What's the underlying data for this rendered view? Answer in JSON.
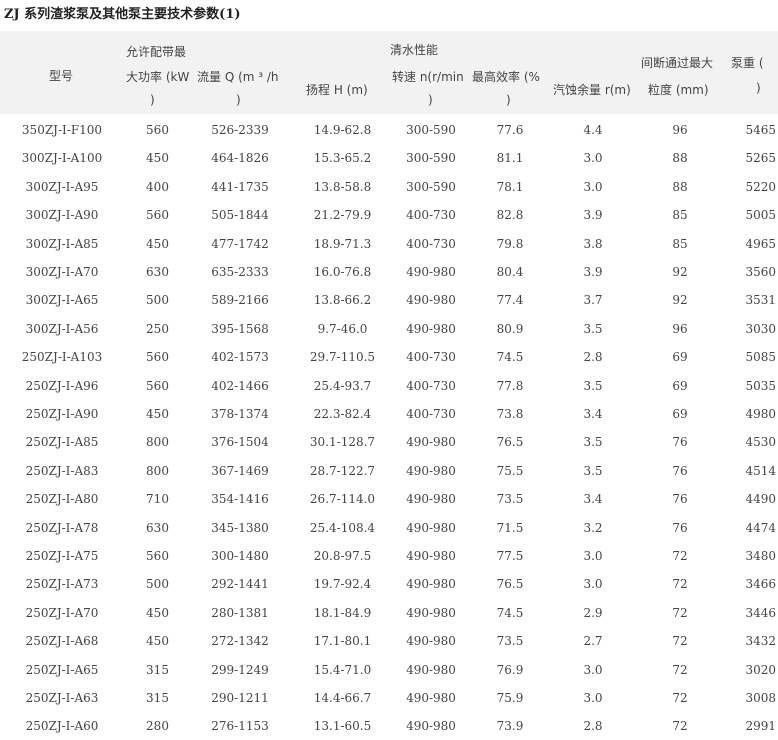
{
  "title": "ZJ 系列渣浆泵及其他泵主要技术参数(1)",
  "header": {
    "model": "型号",
    "power_top": "允许配带最",
    "power_mid": "大功率 (kW",
    "power_bot": ")",
    "clearwater": "清水性能",
    "flow_top": "流量 Q (m ³ /h",
    "flow_bot": ")",
    "head": "扬程 H (m)",
    "speed_top": "转速 n(r/min",
    "speed_bot": ")",
    "eff_top": "最高效率 (%",
    "eff_bot": ")",
    "npsh": "汽蚀余量 r(m)",
    "particle_top": "间断通过最大",
    "particle_bot": "粒度 (mm)",
    "weight_top": "泵重 (",
    "weight_bot": ")"
  },
  "rows": [
    [
      "350ZJ-I-F100",
      "560",
      "526-2339",
      "14.9-62.8",
      "300-590",
      "77.6",
      "4.4",
      "96",
      "5465"
    ],
    [
      "300ZJ-I-A100",
      "450",
      "464-1826",
      "15.3-65.2",
      "300-590",
      "81.1",
      "3.0",
      "88",
      "5265"
    ],
    [
      "300ZJ-I-A95",
      "400",
      "441-1735",
      "13.8-58.8",
      "300-590",
      "78.1",
      "3.0",
      "88",
      "5220"
    ],
    [
      "300ZJ-I-A90",
      "560",
      "505-1844",
      "21.2-79.9",
      "400-730",
      "82.8",
      "3.9",
      "85",
      "5005"
    ],
    [
      "300ZJ-I-A85",
      "450",
      "477-1742",
      "18.9-71.3",
      "400-730",
      "79.8",
      "3.8",
      "85",
      "4965"
    ],
    [
      "300ZJ-I-A70",
      "630",
      "635-2333",
      "16.0-76.8",
      "490-980",
      "80.4",
      "3.9",
      "92",
      "3560"
    ],
    [
      "300ZJ-I-A65",
      "500",
      "589-2166",
      "13.8-66.2",
      "490-980",
      "77.4",
      "3.7",
      "92",
      "3531"
    ],
    [
      "300ZJ-I-A56",
      "250",
      "395-1568",
      "9.7-46.0",
      "490-980",
      "80.9",
      "3.5",
      "96",
      "3030"
    ],
    [
      "250ZJ-I-A103",
      "560",
      "402-1573",
      "29.7-110.5",
      "400-730",
      "74.5",
      "2.8",
      "69",
      "5085"
    ],
    [
      "250ZJ-I-A96",
      "560",
      "402-1466",
      "25.4-93.7",
      "400-730",
      "77.8",
      "3.5",
      "69",
      "5035"
    ],
    [
      "250ZJ-I-A90",
      "450",
      "378-1374",
      "22.3-82.4",
      "400-730",
      "73.8",
      "3.4",
      "69",
      "4980"
    ],
    [
      "250ZJ-I-A85",
      "800",
      "376-1504",
      "30.1-128.7",
      "490-980",
      "76.5",
      "3.5",
      "76",
      "4530"
    ],
    [
      "250ZJ-I-A83",
      "800",
      "367-1469",
      "28.7-122.7",
      "490-980",
      "75.5",
      "3.5",
      "76",
      "4514"
    ],
    [
      "250ZJ-I-A80",
      "710",
      "354-1416",
      "26.7-114.0",
      "490-980",
      "73.5",
      "3.4",
      "76",
      "4490"
    ],
    [
      "250ZJ-I-A78",
      "630",
      "345-1380",
      "25.4-108.4",
      "490-980",
      "71.5",
      "3.2",
      "76",
      "4474"
    ],
    [
      "250ZJ-I-A75",
      "560",
      "300-1480",
      "20.8-97.5",
      "490-980",
      "77.5",
      "3.0",
      "72",
      "3480"
    ],
    [
      "250ZJ-I-A73",
      "500",
      "292-1441",
      "19.7-92.4",
      "490-980",
      "76.5",
      "3.0",
      "72",
      "3466"
    ],
    [
      "250ZJ-I-A70",
      "450",
      "280-1381",
      "18.1-84.9",
      "490-980",
      "74.5",
      "2.9",
      "72",
      "3446"
    ],
    [
      "250ZJ-I-A68",
      "450",
      "272-1342",
      "17.1-80.1",
      "490-980",
      "73.5",
      "2.7",
      "72",
      "3432"
    ],
    [
      "250ZJ-I-A65",
      "315",
      "299-1249",
      "15.4-71.0",
      "490-980",
      "76.9",
      "3.0",
      "72",
      "3020"
    ],
    [
      "250ZJ-I-A63",
      "315",
      "290-1211",
      "14.4-66.7",
      "490-980",
      "75.9",
      "3.0",
      "72",
      "3008"
    ],
    [
      "250ZJ-I-A60",
      "280",
      "276-1153",
      "13.1-60.5",
      "490-980",
      "73.9",
      "2.8",
      "72",
      "2991"
    ]
  ]
}
